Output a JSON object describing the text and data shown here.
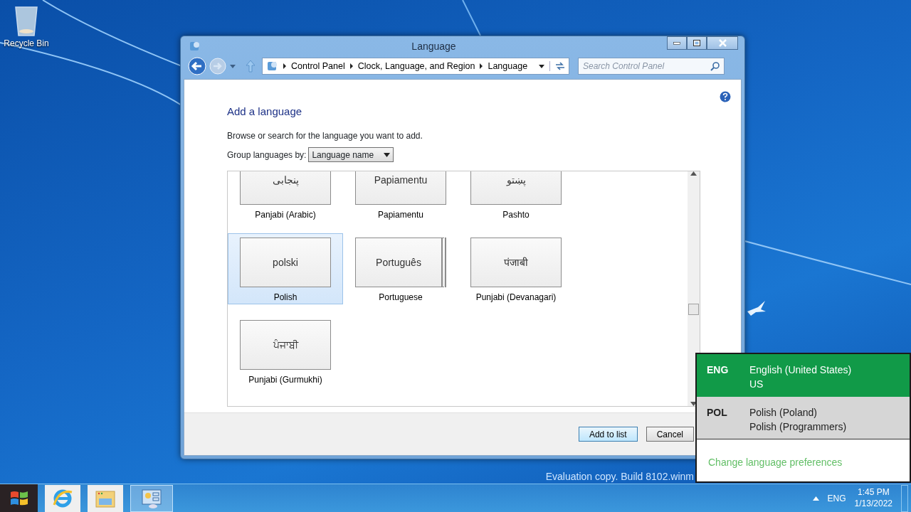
{
  "desktop": {
    "icons": [
      {
        "label": "Recycle Bin"
      }
    ],
    "evaluation_notice": "Evaluation copy. Build 8102.winm"
  },
  "window": {
    "title": "Language",
    "breadcrumb": [
      "Control Panel",
      "Clock, Language, and Region",
      "Language"
    ],
    "search": {
      "placeholder": "Search Control Panel"
    },
    "heading": "Add a language",
    "description": "Browse or search for the language you want to add.",
    "group_by": {
      "label": "Group languages by:",
      "value": "Language name"
    },
    "languages": [
      {
        "native": "پنجابی",
        "name": "Panjabi (Arabic)",
        "selected": false,
        "stacked": false
      },
      {
        "native": "Papiamentu",
        "name": "Papiamentu",
        "selected": false,
        "stacked": false
      },
      {
        "native": "پښتو",
        "name": "Pashto",
        "selected": false,
        "stacked": false
      },
      {
        "native": "polski",
        "name": "Polish",
        "selected": true,
        "stacked": false
      },
      {
        "native": "Português",
        "name": "Portuguese",
        "selected": false,
        "stacked": true
      },
      {
        "native": "पंजाबी",
        "name": "Punjabi (Devanagari)",
        "selected": false,
        "stacked": false
      },
      {
        "native": "ਪੰਜਾਬੀ",
        "name": "Punjabi (Gurmukhi)",
        "selected": false,
        "stacked": false
      }
    ],
    "buttons": [
      {
        "label": "Add to list",
        "kind": "primary"
      },
      {
        "label": "Cancel",
        "kind": "normal"
      }
    ]
  },
  "language_flyout": {
    "items": [
      {
        "code": "ENG",
        "name": "English (United States)",
        "layout": "US",
        "selected": true,
        "hovered": false
      },
      {
        "code": "POL",
        "name": "Polish (Poland)",
        "layout": "Polish (Programmers)",
        "selected": false,
        "hovered": true
      }
    ],
    "link": "Change language preferences"
  },
  "taskbar": {
    "apps": [
      {
        "kind": "browser",
        "active": false
      },
      {
        "kind": "folder",
        "active": false
      },
      {
        "kind": "control-panel",
        "active": true
      }
    ],
    "tray": {
      "language": "ENG",
      "time": "1:45 PM",
      "date": "1/13/2022"
    }
  }
}
